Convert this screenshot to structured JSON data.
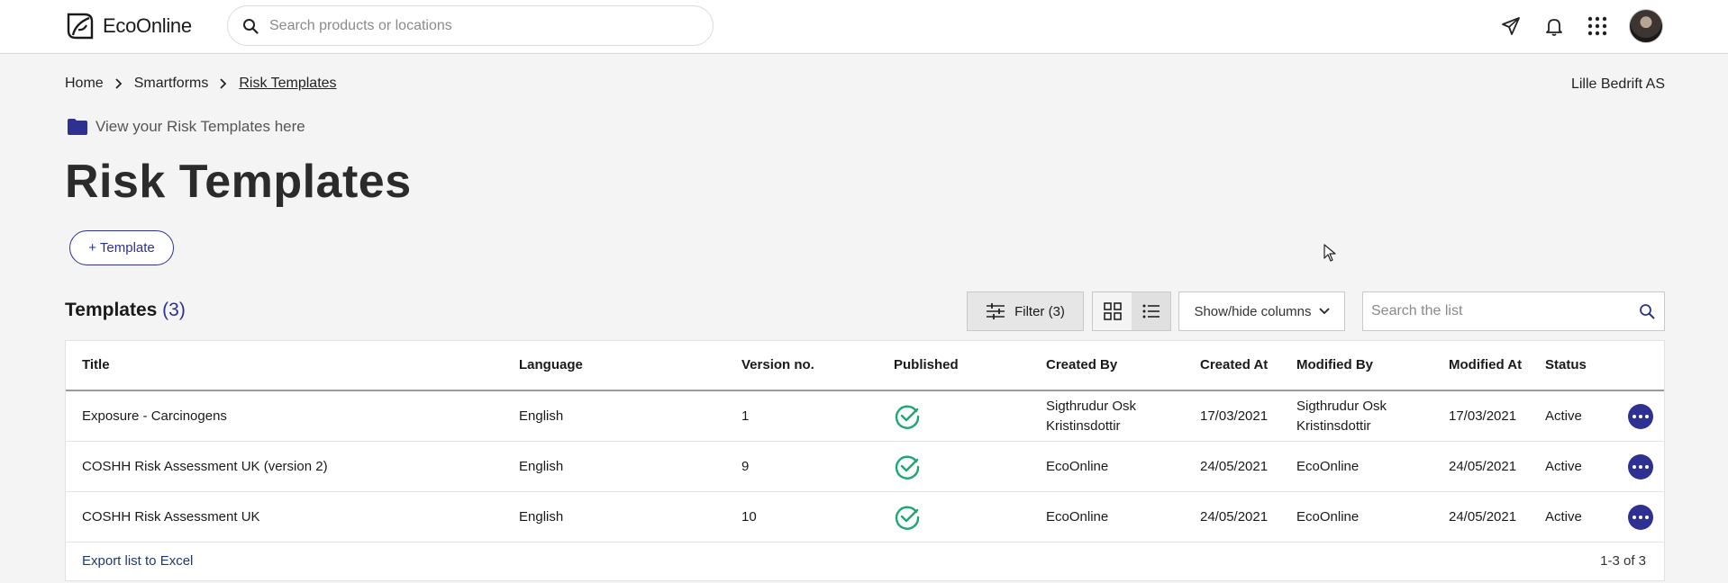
{
  "topbar": {
    "brand": "EcoOnline",
    "search_placeholder": "Search products or locations",
    "icons": [
      "rocket-icon",
      "bell-icon",
      "apps-grid-icon",
      "avatar"
    ]
  },
  "breadcrumb": {
    "items": [
      "Home",
      "Smartforms",
      "Risk Templates"
    ]
  },
  "company": "Lille Bedrift AS",
  "info_text": "View your Risk Templates here",
  "page_title": "Risk Templates",
  "add_button": "+ Template",
  "list": {
    "heading": "Templates",
    "count": "(3)",
    "filter_label": "Filter (3)",
    "columns_label": "Show/hide columns",
    "search_placeholder": "Search the list",
    "headers": [
      "Title",
      "Language",
      "Version no.",
      "Published",
      "Created By",
      "Created At",
      "Modified By",
      "Modified At",
      "Status"
    ],
    "rows": [
      {
        "title": "Exposure - Carcinogens",
        "language": "English",
        "version": "1",
        "created_by": "Sigthrudur Osk Kristinsdottir",
        "created_at": "17/03/2021",
        "modified_by": "Sigthrudur Osk Kristinsdottir",
        "modified_at": "17/03/2021",
        "status": "Active"
      },
      {
        "title": "COSHH Risk Assessment UK (version 2)",
        "language": "English",
        "version": "9",
        "created_by": "EcoOnline",
        "created_at": "24/05/2021",
        "modified_by": "EcoOnline",
        "modified_at": "24/05/2021",
        "status": "Active"
      },
      {
        "title": "COSHH Risk Assessment UK",
        "language": "English",
        "version": "10",
        "created_by": "EcoOnline",
        "created_at": "24/05/2021",
        "modified_by": "EcoOnline",
        "modified_at": "24/05/2021",
        "status": "Active"
      }
    ],
    "export_label": "Export list to Excel",
    "pager": "1-3 of 3"
  },
  "colors": {
    "accent": "#2e3192",
    "published_check": "#1ea672",
    "page_bg": "#f4f4f4"
  }
}
